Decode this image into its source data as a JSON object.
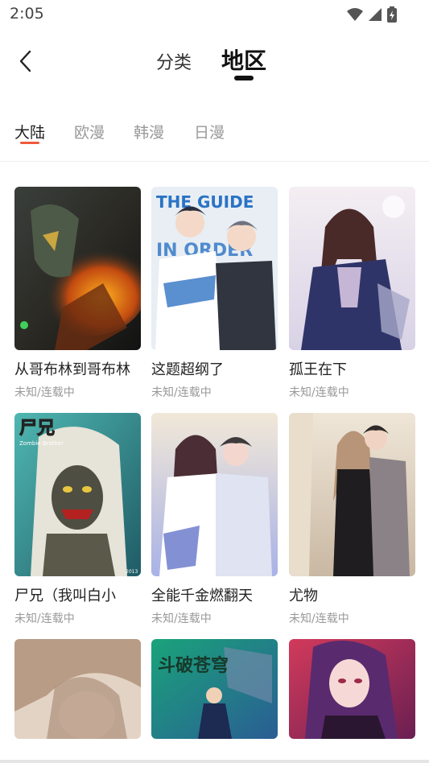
{
  "status_bar": {
    "time": "2:05"
  },
  "nav": {
    "tabs": [
      "分类",
      "地区"
    ],
    "active_tab": "地区"
  },
  "regions": [
    "大陆",
    "欧漫",
    "韩漫",
    "日漫"
  ],
  "comics": [
    {
      "title": "从哥布林到哥布林",
      "status": "未知/连载中"
    },
    {
      "title": "这题超纲了",
      "status": "未知/连载中"
    },
    {
      "title": "孤王在下",
      "status": "未知/连载中"
    },
    {
      "title": "尸兄（我叫白小",
      "status": "未知/连载中"
    },
    {
      "title": "全能千金燃翻天",
      "status": "未知/连载中"
    },
    {
      "title": "尤物",
      "status": "未知/连载中"
    },
    {
      "title": "",
      "status": ""
    },
    {
      "title": "",
      "status": ""
    },
    {
      "title": "",
      "status": ""
    }
  ],
  "cover_text": {
    "c2_banner": "THE GUIDE",
    "c2_banner2": "IN ORDER",
    "c4_logo": "尸兄",
    "c4_sub": "Zombie Brother",
    "c4_year": "2013",
    "c8_logo": "斗破苍穹"
  }
}
